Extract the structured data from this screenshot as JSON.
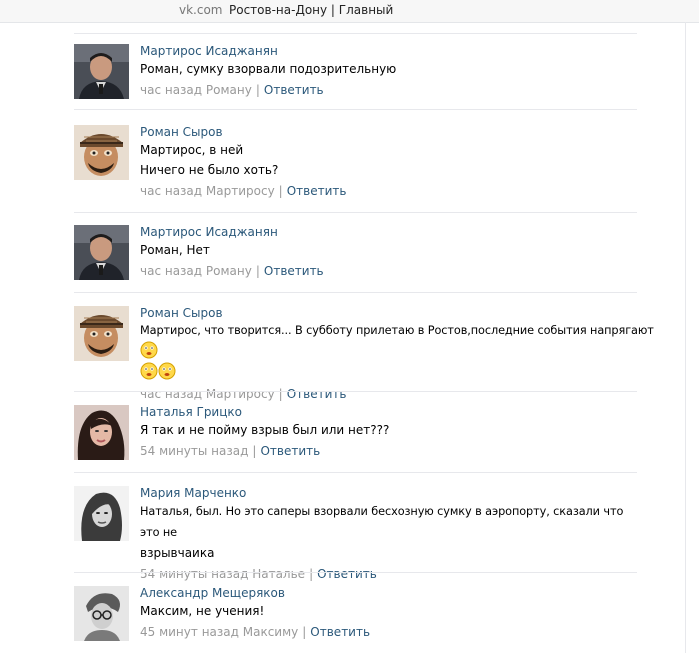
{
  "browser": {
    "domain": "vk.com",
    "title": "Ростов-на-Дону | Главный"
  },
  "comments": [
    {
      "author": "Мартирос Исаджанян",
      "avatar": "martiros-photo",
      "lines": [
        "Роман, сумку взорвали подозрительную"
      ],
      "time": "час назад Роману",
      "reply_label": "Ответить"
    },
    {
      "author": "Роман Сыров",
      "avatar": "roman-photo",
      "lines": [
        "Мартирос, в ней",
        "Ничего не было хоть?"
      ],
      "time": "час назад Мартиросу",
      "reply_label": "Ответить"
    },
    {
      "author": "Мартирос Исаджанян",
      "avatar": "martiros-photo",
      "lines": [
        "Роман, Нет"
      ],
      "time": "час назад Роману",
      "reply_label": "Ответить"
    },
    {
      "author": "Роман Сыров",
      "avatar": "roman-photo",
      "lines": [
        "Мартирос, что творится... В субботу прилетаю в Ростов,последние события напрягают"
      ],
      "emoji_count": 3,
      "time": "час назад Мартиросу",
      "reply_label": "Ответить"
    },
    {
      "author": "Наталья Грицко",
      "avatar": "natalya-photo",
      "lines": [
        "Я так и не пойму взрыв был или нет???"
      ],
      "time": "54 минуты назад",
      "reply_label": "Ответить"
    },
    {
      "author": "Мария Марченко",
      "avatar": "maria-photo",
      "lines": [
        "Наталья, был. Но это саперы взорвали бесхозную сумку в аэропорту, сказали что это не",
        "взрывчаика"
      ],
      "time": "54 минуты назад Наталье",
      "reply_label": "Ответить"
    },
    {
      "author": "Александр Мещеряков",
      "avatar": "alexander-photo",
      "lines": [
        "Максим, не учения!"
      ],
      "time": "45 минут назад Максиму",
      "reply_label": "Ответить"
    }
  ],
  "icons": {
    "emoji": "smile-emoji-icon"
  }
}
